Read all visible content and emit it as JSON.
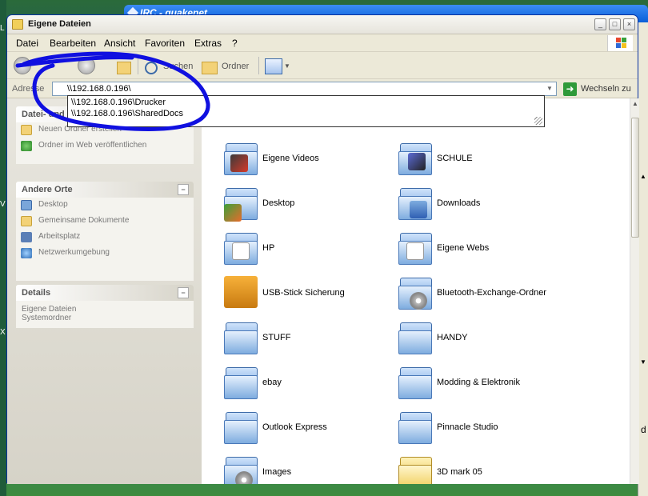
{
  "background": {
    "window_title": "IRC - quakenet",
    "right_strip_letter": "d"
  },
  "window": {
    "title": "Eigene Dateien",
    "controls": [
      "_",
      "□",
      "×"
    ]
  },
  "menu": [
    "Datei",
    "Bearbeiten",
    "Ansicht",
    "Favoriten",
    "Extras",
    "?"
  ],
  "toolbar": {
    "search_label": "Suchen",
    "folders_label": "Ordner"
  },
  "address": {
    "label": "Adresse",
    "value": "\\\\192.168.0.196\\",
    "go_label": "Wechseln zu",
    "suggestions": [
      "\\\\192.168.0.196\\Drucker",
      "\\\\192.168.0.196\\SharedDocs"
    ]
  },
  "tasks": {
    "file_tasks": {
      "title": "Datei- und Ordneraufgaben",
      "items": [
        "Neuen Ordner erstellen",
        "Ordner im Web veröffentlichen"
      ]
    },
    "other_places": {
      "title": "Andere Orte",
      "items": [
        "Desktop",
        "Gemeinsame Dokumente",
        "Arbeitsplatz",
        "Netzwerkumgebung"
      ]
    },
    "details": {
      "title": "Details",
      "lines": [
        "Eigene Dateien",
        "Systemordner"
      ]
    }
  },
  "files": [
    {
      "name": "Eigene Videos",
      "badge": "video"
    },
    {
      "name": "SCHULE",
      "badge": "pen"
    },
    {
      "name": "Desktop",
      "badge": "desktop"
    },
    {
      "name": "Downloads",
      "badge": "download"
    },
    {
      "name": "HP",
      "badge": "web"
    },
    {
      "name": "Eigene Webs",
      "badge": "web"
    },
    {
      "name": "USB-Stick Sicherung",
      "badge": "usb"
    },
    {
      "name": "Bluetooth-Exchange-Ordner",
      "badge": "disc"
    },
    {
      "name": "STUFF",
      "badge": "none"
    },
    {
      "name": "HANDY",
      "badge": "none"
    },
    {
      "name": "ebay",
      "badge": "none"
    },
    {
      "name": "Modding & Elektronik",
      "badge": "none"
    },
    {
      "name": "Outlook Express",
      "badge": "none"
    },
    {
      "name": "Pinnacle Studio",
      "badge": "none"
    },
    {
      "name": "Images",
      "badge": "disc"
    },
    {
      "name": "3D mark 05",
      "badge": "yellow"
    }
  ],
  "annotation_color": "#1010e0"
}
